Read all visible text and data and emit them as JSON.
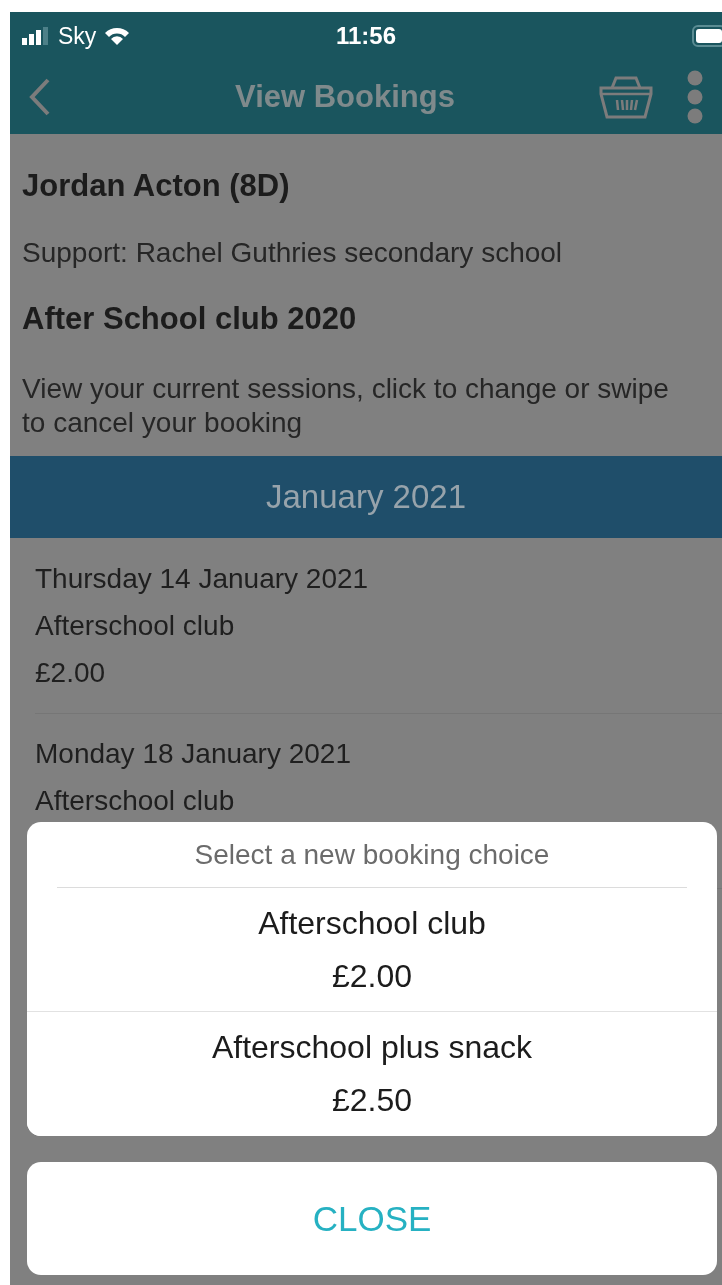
{
  "status_bar": {
    "carrier": "Sky",
    "time": "11:56"
  },
  "nav": {
    "title": "View Bookings"
  },
  "student": {
    "name": "Jordan Acton (8D)",
    "support": "Support: Rachel Guthries secondary school"
  },
  "club": {
    "title": "After School club 2020",
    "description": "View your current sessions, click to change or swipe to cancel your booking"
  },
  "month": "January 2021",
  "bookings": [
    {
      "date": "Thursday 14 January 2021",
      "session": "Afterschool club",
      "price": "£2.00"
    },
    {
      "date": "Monday 18 January 2021",
      "session": "Afterschool club"
    }
  ],
  "sheet": {
    "title": "Select a new booking choice",
    "options": [
      {
        "name": "Afterschool club",
        "price": "£2.00"
      },
      {
        "name": "Afterschool plus snack",
        "price": "£2.50"
      }
    ],
    "close": "CLOSE"
  }
}
